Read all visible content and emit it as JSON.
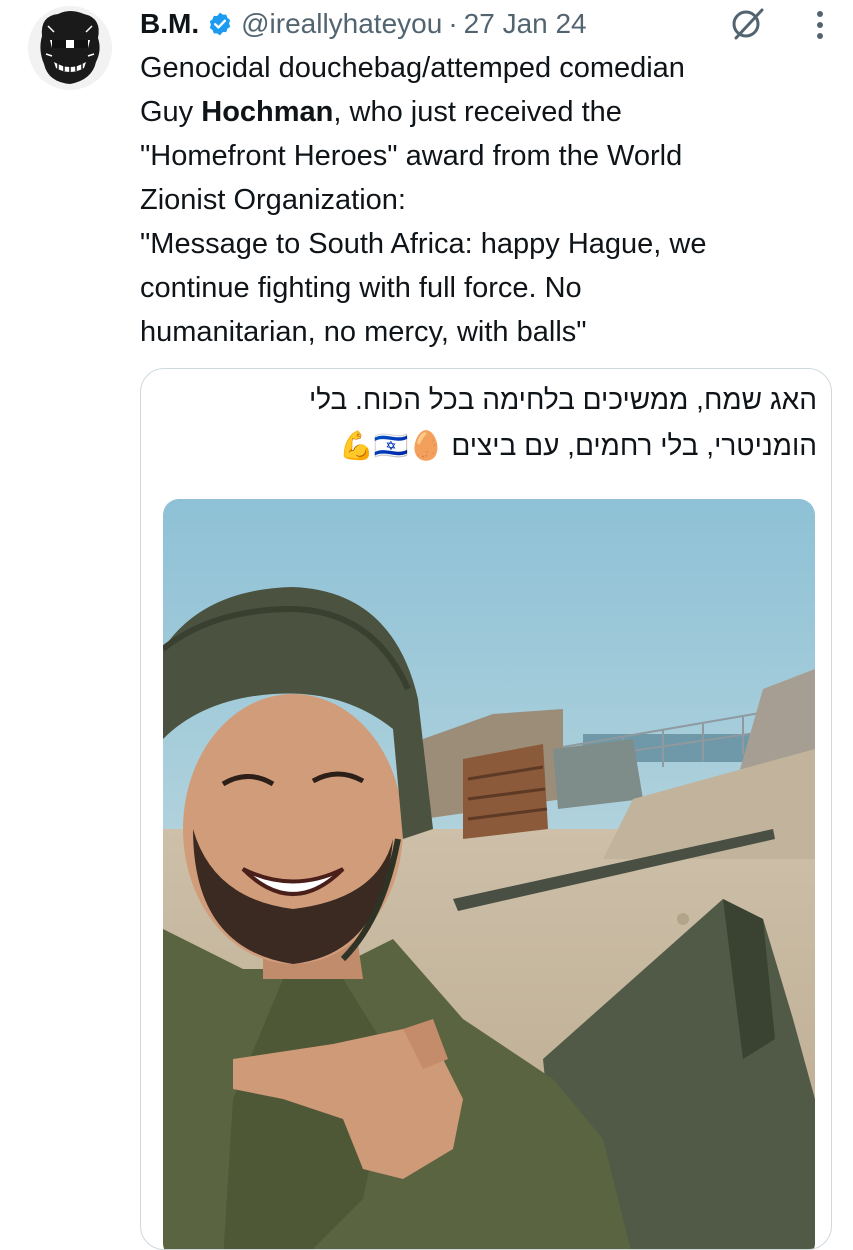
{
  "tweet": {
    "author_name": "B.M.",
    "handle": "@ireallyhateyou",
    "separator": "·",
    "date": "27 Jan 24",
    "text": {
      "line1": "Genocidal douchebag/attemped comedian",
      "line2_pre": "Guy ",
      "line2_bold": "Hochman",
      "line2_post": ", who just received the",
      "line3": "\"Homefront Heroes\" award from the World",
      "line4": "Zionist Organization:",
      "line5": "\"Message to South Africa: happy Hague, we",
      "line6": "continue fighting with full force. No",
      "line7": "humanitarian, no mercy, with balls\""
    }
  },
  "quoted": {
    "hebrew_line1": "האג שמח, ממשיכים בלחימה בכל הכוח. בלי",
    "hebrew_line2": "הומניטרי, בלי רחמים, עם ביצים 🥚🇮🇱💪"
  },
  "icons": {
    "verified": "verified-badge-icon",
    "grok": "grok-icon",
    "more": "more-vertical-icon"
  },
  "colors": {
    "verified_blue": "#1d9bf0",
    "secondary_text": "#536471"
  }
}
